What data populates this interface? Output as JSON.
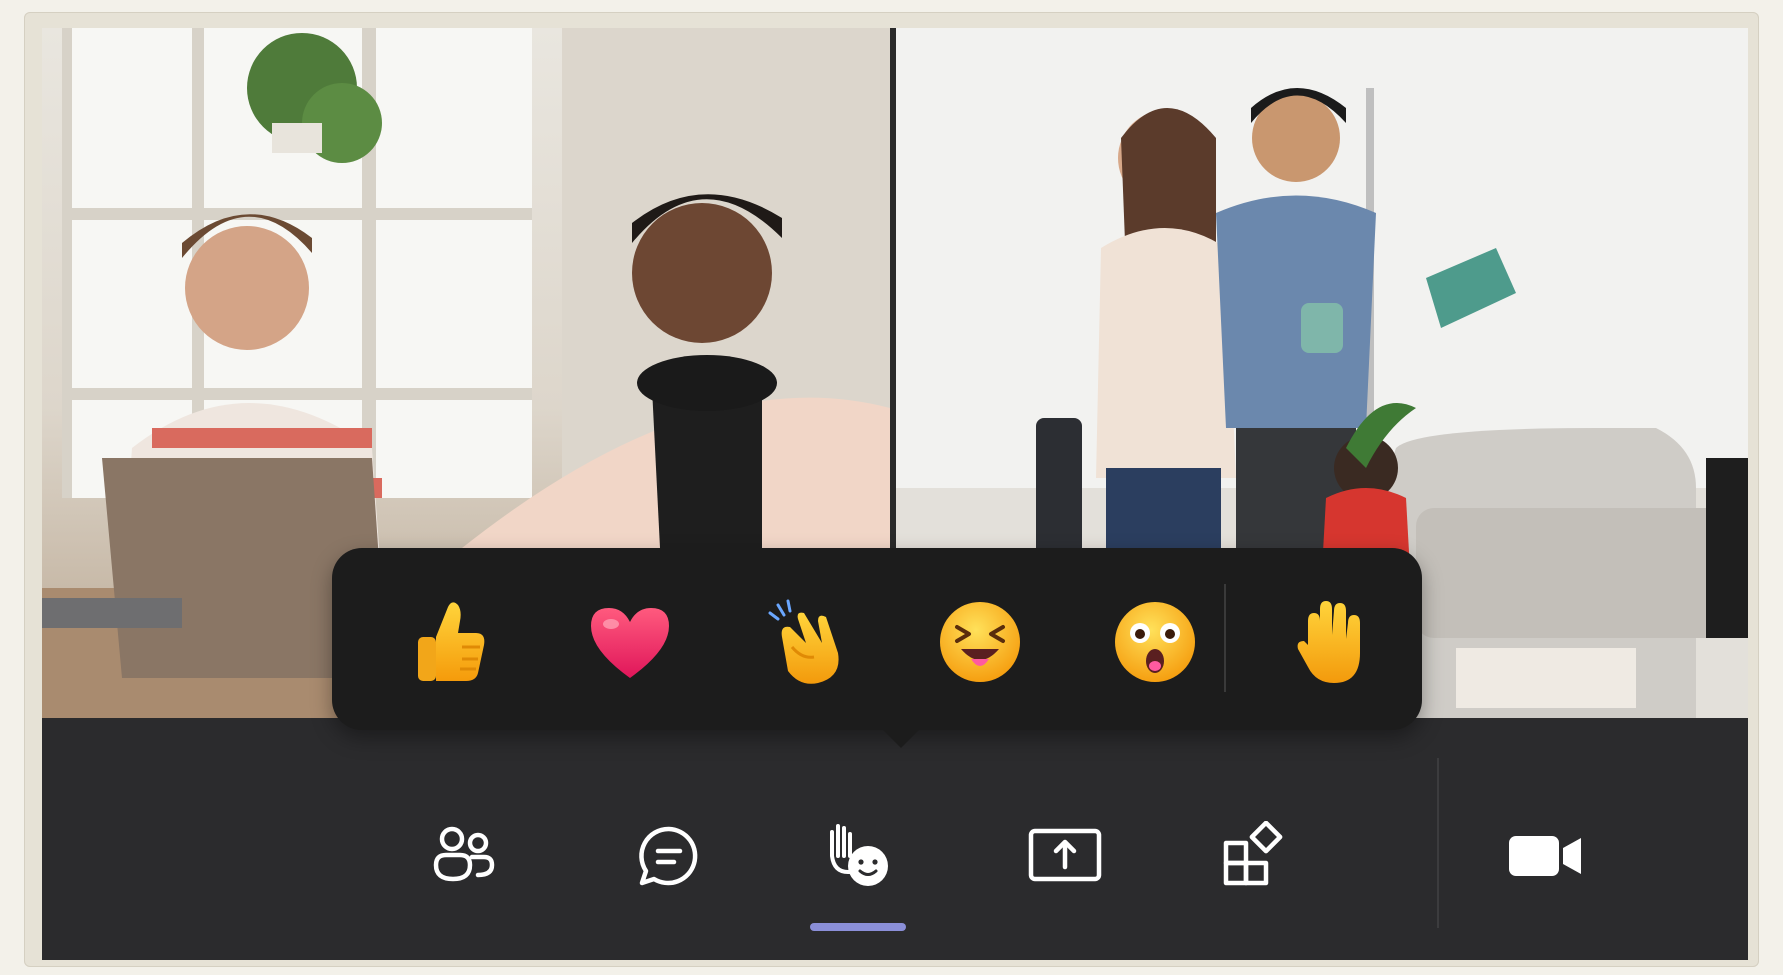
{
  "meeting": {
    "tiles": [
      {
        "name": "participant-tile-1",
        "description_icon": "video-feed"
      },
      {
        "name": "participant-tile-2",
        "description_icon": "video-feed"
      }
    ]
  },
  "reactions": {
    "items": [
      {
        "name": "like-reaction",
        "icon": "thumbs-up-icon"
      },
      {
        "name": "love-reaction",
        "icon": "heart-icon"
      },
      {
        "name": "applause-reaction",
        "icon": "clapping-hands-icon"
      },
      {
        "name": "laugh-reaction",
        "icon": "laughing-face-icon"
      },
      {
        "name": "surprised-reaction",
        "icon": "surprised-face-icon"
      },
      {
        "name": "raise-hand",
        "icon": "raised-hand-icon"
      }
    ]
  },
  "toolbar": {
    "buttons": [
      {
        "name": "people-button",
        "icon": "people-icon"
      },
      {
        "name": "chat-button",
        "icon": "chat-icon"
      },
      {
        "name": "react-button",
        "icon": "react-icon",
        "active": true
      },
      {
        "name": "share-button",
        "icon": "share-screen-icon"
      },
      {
        "name": "apps-button",
        "icon": "apps-icon"
      },
      {
        "name": "camera-button",
        "icon": "video-camera-icon"
      }
    ],
    "accent_color": "#8b8fd8"
  },
  "colors": {
    "popup_bg": "#1c1c1c",
    "toolbar_bg": "#2b2b2d",
    "icon_color": "#ffffff"
  }
}
